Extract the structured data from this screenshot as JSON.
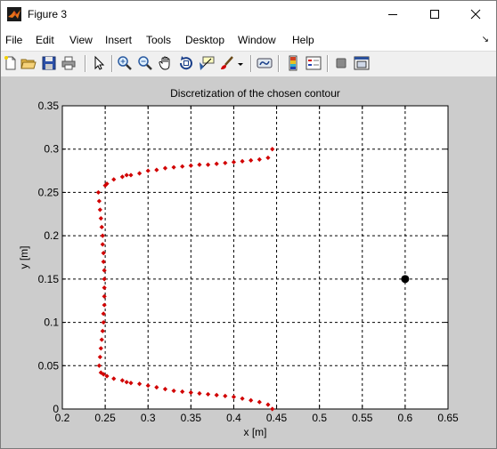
{
  "window": {
    "title": "Figure 3",
    "minimize_icon": "minimize-icon",
    "maximize_icon": "maximize-icon",
    "close_icon": "close-icon"
  },
  "menubar": {
    "items": [
      "File",
      "Edit",
      "View",
      "Insert",
      "Tools",
      "Desktop",
      "Window",
      "Help"
    ],
    "dock_glyph": "↘"
  },
  "toolbar": {
    "icons": [
      "new-figure-icon",
      "open-file-icon",
      "save-icon",
      "print-icon",
      "edit-plot-arrow-icon",
      "zoom-in-icon",
      "zoom-out-icon",
      "pan-hand-icon",
      "rotate-3d-icon",
      "data-cursor-icon",
      "brush-icon",
      "brush-dropdown-icon",
      "link-plot-icon",
      "insert-colorbar-icon",
      "insert-legend-icon",
      "hide-plot-tools-icon",
      "show-plot-tools-icon"
    ]
  },
  "colors": {
    "figure_background": "#cccccc",
    "axes_background": "#ffffff",
    "contour_points": "#d10000",
    "highlight_point": "#000000"
  },
  "chart_data": {
    "type": "scatter",
    "title": "Discretization of the chosen contour",
    "xlabel": "x [m]",
    "ylabel": "y [m]",
    "xlim": [
      0.2,
      0.65
    ],
    "ylim": [
      0,
      0.35
    ],
    "xticks": [
      0.2,
      0.25,
      0.3,
      0.35,
      0.4,
      0.45,
      0.5,
      0.55,
      0.6,
      0.65
    ],
    "yticks": [
      0,
      0.05,
      0.1,
      0.15,
      0.2,
      0.25,
      0.3,
      0.35
    ],
    "xtick_labels": [
      "0.2",
      "0.25",
      "0.3",
      "0.35",
      "0.4",
      "0.45",
      "0.5",
      "0.55",
      "0.6",
      "0.65"
    ],
    "ytick_labels": [
      "0",
      "0.05",
      "0.1",
      "0.15",
      "0.2",
      "0.25",
      "0.3",
      "0.35"
    ],
    "grid": true,
    "grid_style": "dashed",
    "series": [
      {
        "color": "#d10000",
        "marker": "diamond",
        "points": [
          [
            0.445,
            0.0
          ],
          [
            0.44,
            0.005
          ],
          [
            0.43,
            0.008
          ],
          [
            0.42,
            0.01
          ],
          [
            0.41,
            0.012
          ],
          [
            0.4,
            0.014
          ],
          [
            0.39,
            0.015
          ],
          [
            0.38,
            0.016
          ],
          [
            0.37,
            0.017
          ],
          [
            0.36,
            0.018
          ],
          [
            0.35,
            0.019
          ],
          [
            0.34,
            0.02
          ],
          [
            0.33,
            0.021
          ],
          [
            0.32,
            0.023
          ],
          [
            0.31,
            0.025
          ],
          [
            0.3,
            0.027
          ],
          [
            0.29,
            0.029
          ],
          [
            0.28,
            0.03
          ],
          [
            0.275,
            0.031
          ],
          [
            0.27,
            0.033
          ],
          [
            0.26,
            0.035
          ],
          [
            0.252,
            0.038
          ],
          [
            0.248,
            0.04
          ],
          [
            0.245,
            0.042
          ],
          [
            0.243,
            0.05
          ],
          [
            0.244,
            0.06
          ],
          [
            0.245,
            0.07
          ],
          [
            0.246,
            0.08
          ],
          [
            0.247,
            0.09
          ],
          [
            0.248,
            0.1
          ],
          [
            0.248,
            0.11
          ],
          [
            0.249,
            0.12
          ],
          [
            0.249,
            0.13
          ],
          [
            0.249,
            0.14
          ],
          [
            0.249,
            0.15
          ],
          [
            0.249,
            0.16
          ],
          [
            0.248,
            0.17
          ],
          [
            0.248,
            0.18
          ],
          [
            0.247,
            0.19
          ],
          [
            0.247,
            0.2
          ],
          [
            0.246,
            0.21
          ],
          [
            0.245,
            0.22
          ],
          [
            0.244,
            0.23
          ],
          [
            0.243,
            0.24
          ],
          [
            0.242,
            0.25
          ],
          [
            0.25,
            0.258
          ],
          [
            0.252,
            0.26
          ],
          [
            0.26,
            0.265
          ],
          [
            0.27,
            0.268
          ],
          [
            0.275,
            0.27
          ],
          [
            0.28,
            0.27
          ],
          [
            0.29,
            0.272
          ],
          [
            0.3,
            0.275
          ],
          [
            0.31,
            0.276
          ],
          [
            0.32,
            0.278
          ],
          [
            0.33,
            0.279
          ],
          [
            0.34,
            0.28
          ],
          [
            0.35,
            0.281
          ],
          [
            0.36,
            0.282
          ],
          [
            0.37,
            0.282
          ],
          [
            0.38,
            0.283
          ],
          [
            0.39,
            0.284
          ],
          [
            0.4,
            0.285
          ],
          [
            0.41,
            0.286
          ],
          [
            0.42,
            0.287
          ],
          [
            0.43,
            0.288
          ],
          [
            0.44,
            0.29
          ],
          [
            0.445,
            0.3
          ]
        ]
      },
      {
        "color": "#000000",
        "marker": "circle",
        "points": [
          [
            0.6,
            0.15
          ]
        ]
      }
    ]
  }
}
